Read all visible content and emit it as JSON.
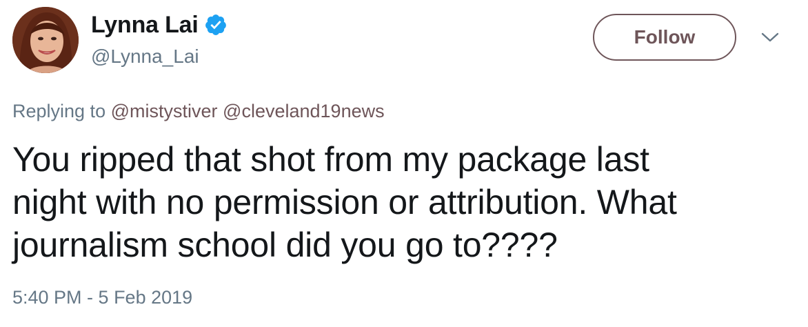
{
  "author": {
    "display_name": "Lynna Lai",
    "handle": "@Lynna_Lai",
    "verified": true,
    "avatar_icon": "profile-photo"
  },
  "actions": {
    "follow_label": "Follow",
    "more_icon": "chevron-down-icon"
  },
  "reply": {
    "prefix": "Replying to",
    "mentions": [
      "@mistystiver",
      "@cleveland19news"
    ]
  },
  "tweet": {
    "lines": [
      "You ripped that shot from my package last",
      "night with no permission or attribution. What",
      "journalism school did you go to????"
    ],
    "timestamp": "5:40 PM - 5 Feb 2019"
  },
  "colors": {
    "text": "#14171a",
    "secondary": "#657786",
    "accent": "#6e5559",
    "verified": "#1da1f2"
  }
}
